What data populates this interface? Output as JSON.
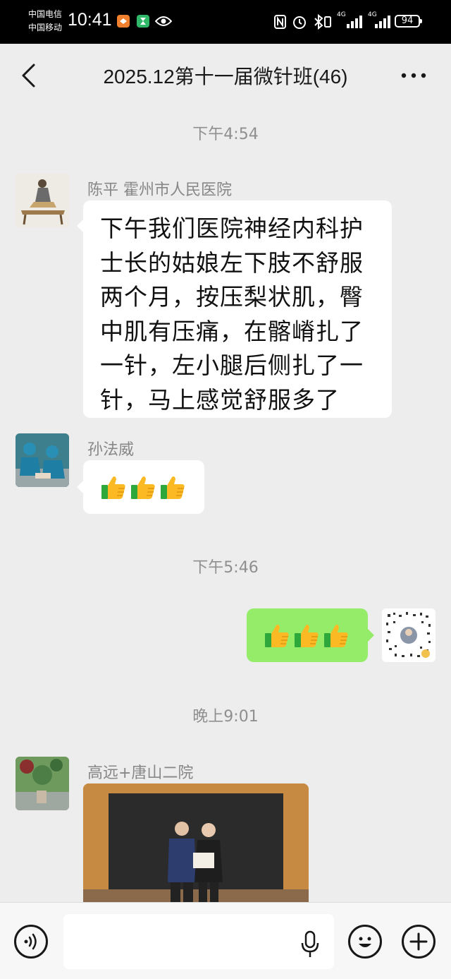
{
  "status_bar": {
    "carrier_1": "中国电信",
    "carrier_2": "中国移动",
    "time": "10:41",
    "network_1": "4G",
    "network_2": "4G",
    "battery": "94"
  },
  "header": {
    "title": "2025.12第十一届微针班(46)"
  },
  "messages": {
    "stamp_1": "下午4:54",
    "m1": {
      "sender": "陈平   霍州市人民医院",
      "text": "下午我们医院神经内科护\n士长的姑娘左下肢不舒服\n两个月，按压梨状肌，臀\n中肌有压痛，在髂嵴扎了\n一针，左小腿后侧扎了一\n针，马上感觉舒服多了"
    },
    "m2": {
      "sender": "孙法威",
      "icons": [
        "thumbs-up-icon",
        "thumbs-up-icon",
        "thumbs-up-icon"
      ]
    },
    "stamp_2": "下午5:46",
    "m3": {
      "icons": [
        "thumbs-up-icon",
        "thumbs-up-icon",
        "thumbs-up-icon"
      ]
    },
    "stamp_3": "晚上9:01",
    "m4": {
      "sender": "高远+唐山二院"
    }
  },
  "colors": {
    "background": "#ededed",
    "incoming_bubble": "#ffffff",
    "outgoing_bubble": "#95ec69",
    "status_bar": "#000000"
  }
}
